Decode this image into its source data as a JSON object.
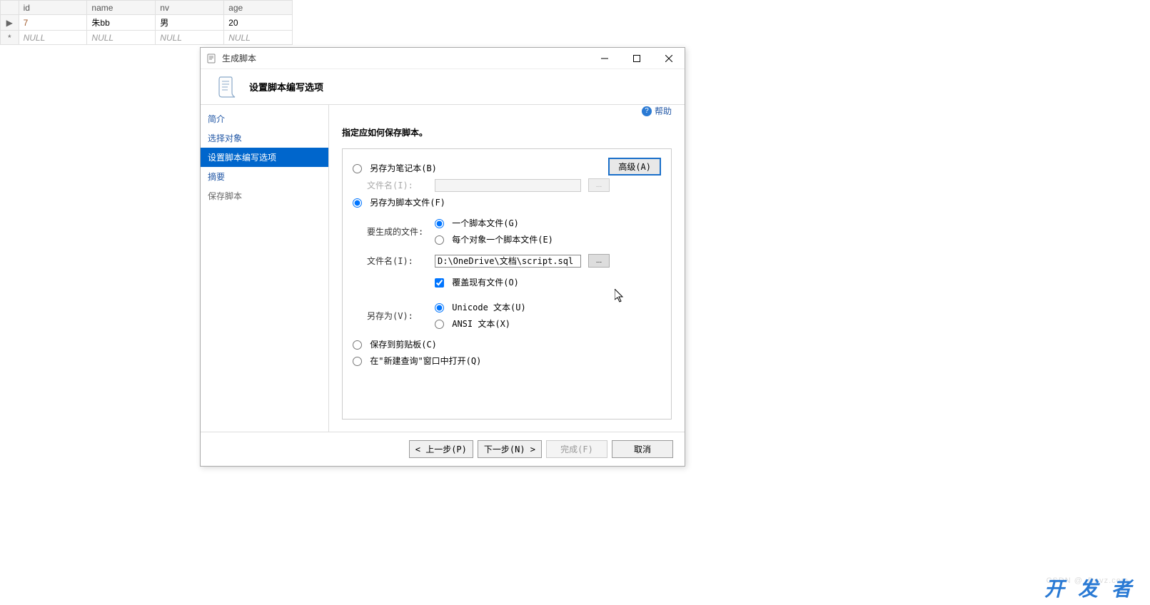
{
  "grid": {
    "headers": [
      "id",
      "name",
      "nv",
      "age"
    ],
    "rows": [
      {
        "marker": "▶",
        "id": "7",
        "name": "朱bb",
        "nv": "男",
        "age": "20",
        "null_row": false
      },
      {
        "marker": "*",
        "id": "NULL",
        "name": "NULL",
        "nv": "NULL",
        "age": "NULL",
        "null_row": true
      }
    ]
  },
  "dialog": {
    "title": "生成脚本",
    "page_title": "设置脚本编写选项",
    "help_label": "帮助",
    "sidebar": {
      "steps": [
        {
          "label": "简介"
        },
        {
          "label": "选择对象"
        },
        {
          "label": "设置脚本编写选项"
        },
        {
          "label": "摘要"
        },
        {
          "label": "保存脚本"
        }
      ],
      "active_index": 2
    },
    "content": {
      "section_title": "指定应如何保存脚本。",
      "advanced_button": "高级(A)",
      "save_as_notebook": "另存为笔记本(B)",
      "filename_label_disabled": "文件名(I):",
      "save_as_script_file": "另存为脚本文件(F)",
      "files_to_generate_label": "要生成的文件:",
      "single_script_file": "一个脚本文件(G)",
      "per_object_file": "每个对象一个脚本文件(E)",
      "filename_label": "文件名(I):",
      "filename_value": "D:\\OneDrive\\文档\\script.sql",
      "browse_label": "...",
      "overwrite_existing": "覆盖现有文件(O)",
      "save_as_label": "另存为(V):",
      "unicode_text": "Unicode 文本(U)",
      "ansi_text": "ANSI 文本(X)",
      "save_to_clipboard": "保存到剪贴板(C)",
      "open_in_new_query": "在\"新建查询\"窗口中打开(Q)"
    },
    "footer": {
      "prev": "< 上一步(P)",
      "next": "下一步(N) >",
      "finish": "完成(F)",
      "cancel": "取消"
    }
  },
  "watermark": {
    "line1": "CSDN @_Devz.com",
    "han": "开 发 者"
  }
}
